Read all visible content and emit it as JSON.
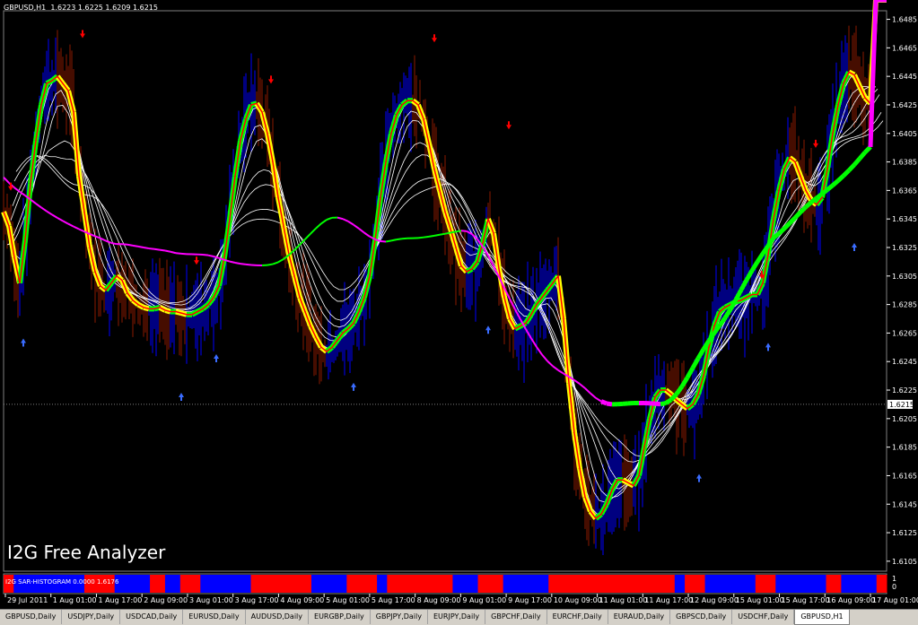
{
  "chart": {
    "symbol": "GBPUSD,H1",
    "ohlc": "1.6223 1.6225 1.6209 1.6215",
    "current_price": "1.6215",
    "watermark": "I2G Free Analyzer",
    "indicator_label": "I2G SAR-HISTOGRAM 0.0000 1.6176",
    "indicator_scale": [
      "1",
      "0"
    ],
    "price_labels": [
      "1.6485",
      "1.6465",
      "1.6445",
      "1.6425",
      "1.6405",
      "1.6385",
      "1.6365",
      "1.6345",
      "1.6325",
      "1.6305",
      "1.6285",
      "1.6265",
      "1.6245",
      "1.6225",
      "1.6205",
      "1.6185",
      "1.6165",
      "1.6145",
      "1.6125",
      "1.6105"
    ],
    "time_labels": [
      "29 Jul 2011",
      "1 Aug 01:00",
      "1 Aug 17:00",
      "2 Aug 09:00",
      "3 Aug 01:00",
      "3 Aug 17:00",
      "4 Aug 09:00",
      "5 Aug 01:00",
      "5 Aug 17:00",
      "8 Aug 09:00",
      "9 Aug 01:00",
      "9 Aug 17:00",
      "10 Aug 09:00",
      "11 Aug 01:00",
      "11 Aug 17:00",
      "12 Aug 09:00",
      "15 Aug 01:00",
      "15 Aug 17:00",
      "16 Aug 09:00",
      "17 Aug 01:00"
    ],
    "colors": {
      "background": "#000000",
      "up_candles": "#0000ff",
      "down_candles": "#8b1a00",
      "green": "#00ff00",
      "yellow": "#ffff00",
      "red": "#ff0000",
      "white": "#ffffff",
      "magenta": "#ff00ff",
      "histogram_red": "#ff0000",
      "histogram_blue": "#0000ff"
    },
    "ma_series": [
      {
        "x": [
          0,
          6,
          12,
          18,
          24,
          30,
          36,
          42,
          48,
          54,
          60,
          66,
          72,
          78,
          84,
          90,
          96,
          102,
          108,
          114,
          120,
          126,
          132,
          138,
          144,
          150,
          156,
          162,
          168,
          174,
          180,
          186,
          192,
          198,
          204,
          210,
          216,
          222,
          228,
          234,
          240,
          246,
          252,
          258,
          264,
          270,
          276,
          282,
          288,
          294,
          300,
          306,
          312,
          318,
          324,
          330,
          336,
          342,
          348,
          354,
          360,
          366,
          372,
          378,
          384,
          390,
          396,
          402,
          408,
          414,
          420,
          426,
          432,
          438,
          444,
          450,
          456,
          462,
          468,
          474,
          480,
          486,
          492,
          498,
          504,
          510,
          516,
          522,
          528,
          534,
          540,
          546,
          552,
          558,
          564,
          570,
          576,
          582,
          588,
          594,
          600,
          606,
          612,
          618,
          624,
          630,
          636,
          642,
          648,
          654,
          660,
          666,
          672,
          678,
          684,
          690,
          696,
          702,
          708,
          714,
          720,
          726,
          732,
          738,
          744,
          750,
          756,
          762,
          768,
          774,
          780,
          786,
          792,
          798,
          804,
          810,
          816,
          822,
          828,
          834,
          840,
          846,
          852,
          858,
          864,
          870,
          876,
          882,
          888,
          894,
          900,
          906,
          912,
          918,
          924,
          930,
          936,
          942,
          948,
          954,
          960,
          966,
          972,
          978,
          984
        ],
        "y": [
          1.635,
          1.634,
          1.6318,
          1.63,
          1.633,
          1.637,
          1.64,
          1.6425,
          1.644,
          1.6442,
          1.6445,
          1.644,
          1.6435,
          1.642,
          1.6375,
          1.635,
          1.6325,
          1.6308,
          1.6298,
          1.6295,
          1.63,
          1.6305,
          1.6302,
          1.6293,
          1.6288,
          1.6285,
          1.6283,
          1.6282,
          1.6282,
          1.6283,
          1.6281,
          1.628,
          1.628,
          1.6279,
          1.6278,
          1.6278,
          1.628,
          1.6282,
          1.6285,
          1.629,
          1.6298,
          1.6318,
          1.6345,
          1.6375,
          1.64,
          1.6415,
          1.6425,
          1.6426,
          1.642,
          1.6405,
          1.6385,
          1.636,
          1.634,
          1.632,
          1.6305,
          1.629,
          1.628,
          1.627,
          1.6262,
          1.6255,
          1.6252,
          1.6255,
          1.626,
          1.6265,
          1.6268,
          1.6272,
          1.628,
          1.629,
          1.6305,
          1.633,
          1.636,
          1.6385,
          1.6405,
          1.6418,
          1.6425,
          1.6428,
          1.6428,
          1.6425,
          1.6415,
          1.6398,
          1.638,
          1.6365,
          1.635,
          1.6338,
          1.6325,
          1.6312,
          1.6308,
          1.631,
          1.6315,
          1.6328,
          1.6345,
          1.6335,
          1.631,
          1.629,
          1.6275,
          1.6268,
          1.627,
          1.6272,
          1.6278,
          1.6285,
          1.629,
          1.6295,
          1.63,
          1.6305,
          1.6275,
          1.623,
          1.6195,
          1.617,
          1.615,
          1.614,
          1.6135,
          1.6138,
          1.6145,
          1.6155,
          1.6162,
          1.6162,
          1.616,
          1.6158,
          1.6165,
          1.6185,
          1.6205,
          1.622,
          1.6225,
          1.6225,
          1.6222,
          1.6218,
          1.6215,
          1.6212,
          1.6215,
          1.6222,
          1.6235,
          1.6255,
          1.627,
          1.628,
          1.6283,
          1.6285,
          1.6287,
          1.6288,
          1.629,
          1.6292,
          1.6292,
          1.63,
          1.632,
          1.6345,
          1.6365,
          1.638,
          1.6388,
          1.6385,
          1.6375,
          1.6365,
          1.6358,
          1.6355,
          1.636,
          1.638,
          1.6405,
          1.6425,
          1.644,
          1.6448,
          1.6446,
          1.6438,
          1.643,
          1.6426
        ]
      }
    ],
    "sar_histogram": [
      "R",
      "R",
      "B",
      "B",
      "B",
      "B",
      "B",
      "B",
      "B",
      "B",
      "B",
      "B",
      "B",
      "B",
      "B",
      "B",
      "R",
      "R",
      "R",
      "R",
      "R",
      "R",
      "B",
      "B",
      "B",
      "B",
      "B",
      "B",
      "B",
      "R",
      "R",
      "R",
      "B",
      "B",
      "B",
      "R",
      "R",
      "R",
      "R",
      "B",
      "B",
      "B",
      "B",
      "B",
      "B",
      "B",
      "B",
      "B",
      "B",
      "R",
      "R",
      "R",
      "R",
      "R",
      "R",
      "R",
      "R",
      "R",
      "R",
      "R",
      "R",
      "B",
      "B",
      "B",
      "B",
      "B",
      "B",
      "B",
      "R",
      "R",
      "R",
      "R",
      "R",
      "R",
      "B",
      "B",
      "R",
      "R",
      "R",
      "R",
      "R",
      "R",
      "R",
      "R",
      "R",
      "R",
      "R",
      "R",
      "R",
      "B",
      "B",
      "B",
      "B",
      "B",
      "R",
      "R",
      "R",
      "R",
      "R",
      "B",
      "B",
      "B",
      "B",
      "B",
      "B",
      "B",
      "B",
      "B",
      "R",
      "R",
      "R",
      "R",
      "R",
      "R",
      "R",
      "R",
      "R",
      "R",
      "R",
      "R",
      "R",
      "R",
      "R",
      "R",
      "R",
      "R",
      "R",
      "R",
      "R",
      "R",
      "R",
      "R",
      "R",
      "B",
      "B",
      "R",
      "R",
      "R",
      "R",
      "B",
      "B",
      "B",
      "B",
      "B",
      "B",
      "B",
      "B",
      "B",
      "B",
      "R",
      "R",
      "R",
      "R",
      "B",
      "B",
      "B",
      "B",
      "B",
      "B",
      "B",
      "B",
      "B",
      "B",
      "R",
      "R",
      "R",
      "B",
      "B",
      "B",
      "B",
      "B",
      "B",
      "B",
      "R",
      "R"
    ],
    "up_arrows": [
      [
        22,
        1.6258
      ],
      [
        198,
        1.622
      ],
      [
        237,
        1.6247
      ],
      [
        390,
        1.6227
      ],
      [
        540,
        1.6267
      ],
      [
        775,
        1.6163
      ],
      [
        852,
        1.6255
      ],
      [
        948,
        1.6325
      ]
    ],
    "down_arrows": [
      [
        8,
        1.6368
      ],
      [
        88,
        1.6475
      ],
      [
        215,
        1.6316
      ],
      [
        298,
        1.6443
      ],
      [
        480,
        1.6472
      ],
      [
        563,
        1.6411
      ],
      [
        845,
        1.6306
      ],
      [
        905,
        1.6398
      ]
    ]
  },
  "tabs": [
    "GBPUSD,Daily",
    "USDJPY,Daily",
    "USDCAD,Daily",
    "EURUSD,Daily",
    "AUDUSD,Daily",
    "EURGBP,Daily",
    "GBPJPY,Daily",
    "EURJPY,Daily",
    "GBPCHF,Daily",
    "EURCHF,Daily",
    "EURAUD,Daily",
    "GBPSCD,Daily",
    "USDCHF,Daily",
    "GBPUSD,H1"
  ],
  "active_tab": "GBPUSD,H1"
}
